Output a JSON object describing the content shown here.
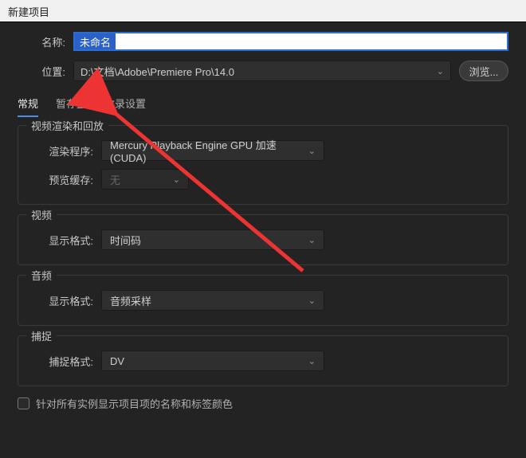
{
  "title": "新建项目",
  "name_label": "名称:",
  "name_value": "未命名",
  "location_label": "位置:",
  "location_value": "D:\\文档\\Adobe\\Premiere Pro\\14.0",
  "browse_label": "浏览...",
  "tabs": {
    "general": "常规",
    "scratch": "暂存盘",
    "ingest": "收录设置"
  },
  "video_render_legend": "视频渲染和回放",
  "renderer_label": "渲染程序:",
  "renderer_value": "Mercury Playback Engine GPU 加速 (CUDA)",
  "preview_cache_label": "预览缓存:",
  "preview_cache_value": "无",
  "video_legend": "视频",
  "video_format_label": "显示格式:",
  "video_format_value": "时间码",
  "audio_legend": "音频",
  "audio_format_label": "显示格式:",
  "audio_format_value": "音频采样",
  "capture_legend": "捕捉",
  "capture_format_label": "捕捉格式:",
  "capture_format_value": "DV",
  "checkbox_label": "针对所有实例显示项目项的名称和标签颜色"
}
